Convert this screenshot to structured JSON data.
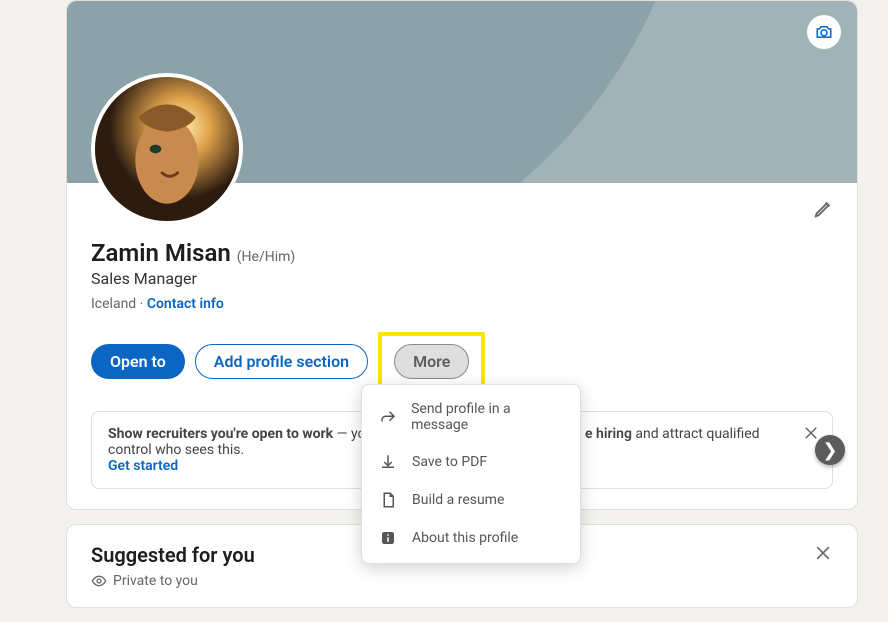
{
  "profile": {
    "name": "Zamin Misan",
    "pronouns": "(He/Him)",
    "headline": "Sales Manager",
    "location": "Iceland",
    "contact_label": "Contact info"
  },
  "buttons": {
    "open_to": "Open to",
    "add_section": "Add profile section",
    "more": "More"
  },
  "dropdown": {
    "items": [
      {
        "label": "Send profile in a message",
        "icon": "share-arrow-icon"
      },
      {
        "label": "Save to PDF",
        "icon": "download-icon"
      },
      {
        "label": "Build a resume",
        "icon": "document-icon"
      },
      {
        "label": "About this profile",
        "icon": "info-icon"
      }
    ]
  },
  "promo": {
    "recruiters_prefix": "Show recruiters you're open to work",
    "recruiters_mid": " — yo",
    "hiring_word": "e hiring",
    "hiring_rest": " and attract qualified",
    "control_line": "control who sees this.",
    "get_started": "Get started"
  },
  "suggested": {
    "title": "Suggested for you",
    "private": "Private to you"
  }
}
